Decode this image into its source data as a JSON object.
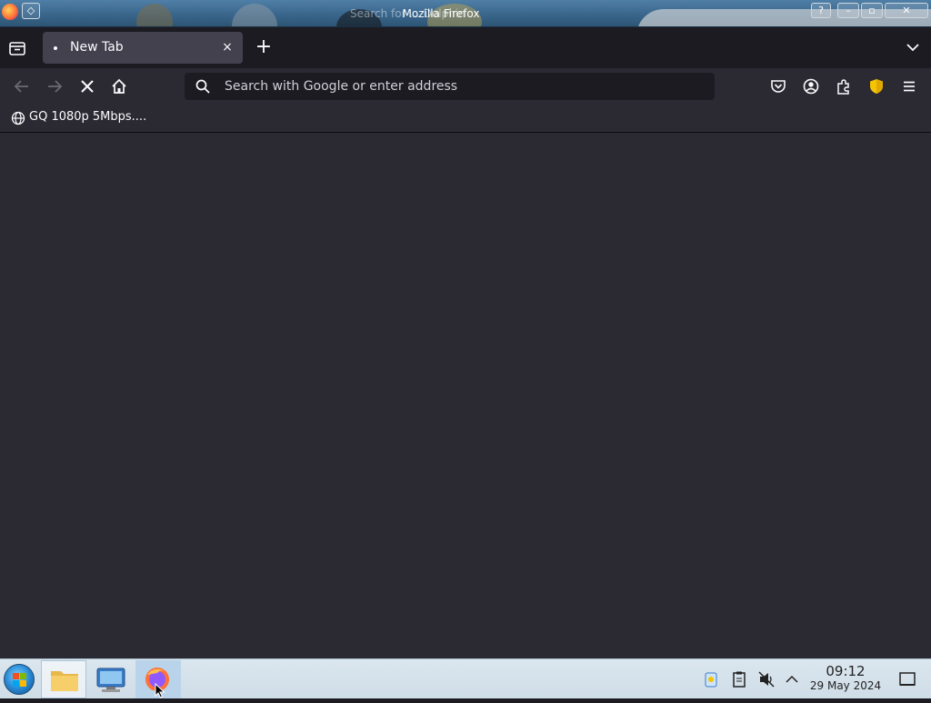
{
  "window": {
    "title": "Mozilla Firefox",
    "ghost_title": "Search for ... Dolphin",
    "help_label": "?",
    "minimize_label": "–",
    "maximize_label": "▫",
    "close_label": "✕"
  },
  "tabs": [
    {
      "label": "New Tab",
      "close_label": "×"
    }
  ],
  "new_tab_label": "+",
  "urlbar": {
    "placeholder": "Search with Google or enter address",
    "value": ""
  },
  "bookmarks": [
    {
      "label": "GQ 1080p 5Mbps...."
    }
  ],
  "taskbar": {
    "clock_time": "09:12",
    "clock_date": "29 May 2024"
  },
  "colors": {
    "toolbar": "#2b2a33",
    "tabstrip": "#1c1b22",
    "selected_tab": "#42414d",
    "text": "#fbfbfe",
    "shield": "#f5c400"
  },
  "icons": {
    "tab_list": "tab-list-icon",
    "back": "back-arrow-icon",
    "forward": "forward-arrow-icon",
    "stop": "stop-icon",
    "home": "home-icon",
    "search": "search-icon",
    "pocket": "pocket-icon",
    "account": "account-icon",
    "extensions": "extensions-icon",
    "shield": "shield-icon",
    "menu": "hamburger-menu-icon"
  }
}
